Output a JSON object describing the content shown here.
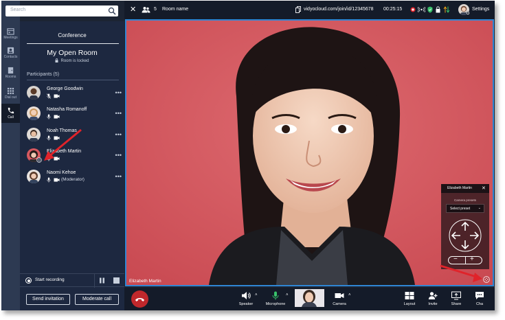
{
  "search": {
    "placeholder": "Search"
  },
  "rail": {
    "items": [
      {
        "label": "Meetings",
        "icon": "calendar-icon"
      },
      {
        "label": "Contacts",
        "icon": "contacts-icon"
      },
      {
        "label": "Rooms",
        "icon": "rooms-icon"
      },
      {
        "label": "Dial out",
        "icon": "dialpad-icon"
      },
      {
        "label": "Call",
        "icon": "phone-icon",
        "active": true
      }
    ]
  },
  "panel": {
    "title": "Conference",
    "room_name": "My Open Room",
    "room_status": "Room is locked",
    "participants_header": "Participants (5)",
    "participants": [
      {
        "name": "George Goodwin",
        "mic_muted": true,
        "camera": true,
        "note": ""
      },
      {
        "name": "Natasha Romanoff",
        "mic_muted": false,
        "camera": true,
        "note": ""
      },
      {
        "name": "Noah Thomas",
        "mic_muted": false,
        "camera": true,
        "note": ""
      },
      {
        "name": "Elizabeth Martin",
        "mic_muted": false,
        "camera": true,
        "note": ""
      },
      {
        "name": "Naomi Kehoe",
        "mic_muted": false,
        "camera": true,
        "note": "(Moderator)"
      }
    ],
    "more_label": "•••",
    "start_recording": "Start recording",
    "send_invitation": "Send invitation",
    "moderate_call": "Moderate call"
  },
  "topbar": {
    "close": "✕",
    "participant_count": "5",
    "room_name": "Room name",
    "url": "vidyocloud.com/join/id/12345678",
    "elapsed": "00:25:15",
    "settings": "Settings"
  },
  "video": {
    "speaker_name": "Elizabeth Martin"
  },
  "camera_control": {
    "title": "Elizabeth Martin",
    "close": "✕",
    "presets_label": "Camera presets",
    "select_preset": "Select preset",
    "zoom_out": "−",
    "zoom_in": "+"
  },
  "toolbar": {
    "speaker": "Speaker",
    "microphone": "Microphone",
    "camera": "Camera",
    "layout": "Layout",
    "invite": "Invite",
    "share": "Share",
    "chat": "Cha",
    "caret": "˄"
  },
  "colors": {
    "accent": "#2f86d4",
    "hangup": "#c0282c",
    "mic_active": "#38c26a",
    "annotation": "#e0232a"
  }
}
